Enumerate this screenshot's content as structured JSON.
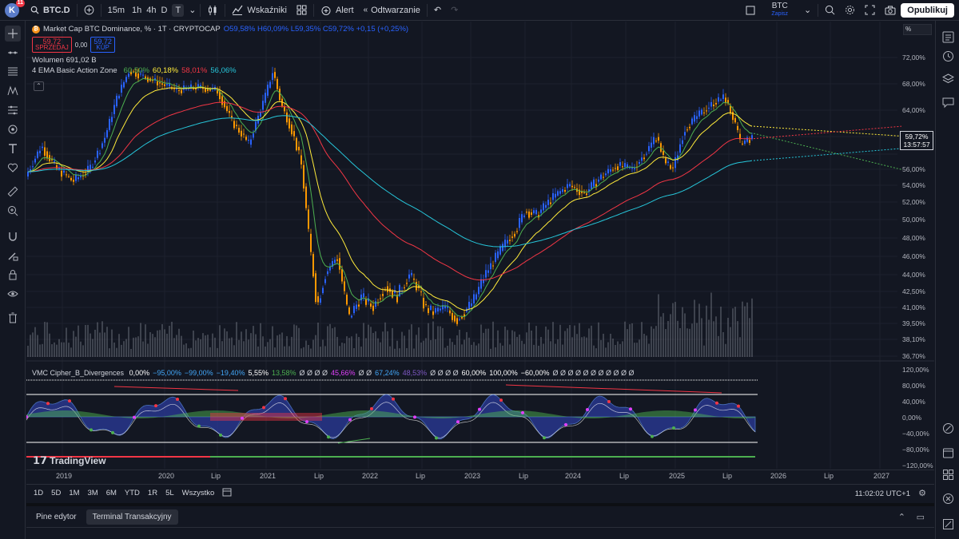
{
  "topbar": {
    "avatar_letter": "K",
    "avatar_badge": "11",
    "symbol": "BTC.D",
    "timeframes": [
      "15m",
      "1h",
      "4h",
      "D",
      "T"
    ],
    "active_timeframe": "T",
    "indicators_label": "Wskaźniki",
    "alert_label": "Alert",
    "replay_label": "Odtwarzanie",
    "symbol_box": "BTC",
    "symbol_box_sub": "Zapisz",
    "publish_label": "Opublikuj"
  },
  "legend": {
    "title": "Market Cap BTC Dominance, % · 1T · CRYPTOCAP",
    "ohlc": "O59,58% H60,09% L59,35% C59,72% +0,15 (+0,25%)",
    "sell_price": "59,72",
    "sell_label": "SPRZEDAJ",
    "spread": "0,00",
    "buy_price": "59,72",
    "buy_label": "KUP",
    "volume": "Wolumen  691,02 B",
    "ema_label": "4 EMA Basic Action Zone",
    "ema_values": [
      {
        "v": "60,50%",
        "color": "#4caf50"
      },
      {
        "v": "60,18%",
        "color": "#ffeb3b"
      },
      {
        "v": "58,01%",
        "color": "#f23645"
      },
      {
        "v": "56,06%",
        "color": "#26c6da"
      }
    ]
  },
  "cipher_legend": {
    "name": "VMC Cipher_B_Divergences",
    "values": [
      {
        "v": "0,00%",
        "color": "#ffffff"
      },
      {
        "v": "−95,00%",
        "color": "#42a5f5"
      },
      {
        "v": "−99,00%",
        "color": "#42a5f5"
      },
      {
        "v": "−19,40%",
        "color": "#42a5f5"
      },
      {
        "v": "5,55%",
        "color": "#ffffff"
      },
      {
        "v": "13,58%",
        "color": "#4caf50"
      },
      {
        "v": "Ø Ø Ø Ø",
        "color": "#d1d4dc"
      },
      {
        "v": "45,66%",
        "color": "#e040fb"
      },
      {
        "v": "Ø Ø",
        "color": "#d1d4dc"
      },
      {
        "v": "67,24%",
        "color": "#42a5f5"
      },
      {
        "v": "48,53%",
        "color": "#7e57c2"
      },
      {
        "v": "Ø Ø Ø Ø",
        "color": "#d1d4dc"
      },
      {
        "v": "60,00%",
        "color": "#ffffff"
      },
      {
        "v": "100,00%",
        "color": "#ffffff"
      },
      {
        "v": "−60,00%",
        "color": "#ffffff"
      },
      {
        "v": "Ø Ø Ø Ø Ø Ø Ø Ø Ø Ø Ø",
        "color": "#d1d4dc"
      }
    ]
  },
  "price_axis": {
    "unit_box": "%",
    "labels": [
      "72,00%",
      "68,00%",
      "64,00%",
      "60,00%",
      "58,00%",
      "56,00%",
      "54,00%",
      "52,00%",
      "50,00%",
      "48,00%",
      "46,00%",
      "44,00%",
      "42,50%",
      "41,00%",
      "39,50%",
      "38,10%",
      "36,70%"
    ],
    "current_price": "59,72%",
    "countdown": "13:57:57"
  },
  "osc_axis": {
    "labels": [
      "120,00%",
      "80,00%",
      "40,00%",
      "0,00%",
      "−40,00%",
      "−80,00%",
      "−120,00%"
    ]
  },
  "time_axis": {
    "labels": [
      "2019",
      "2020",
      "Lip",
      "2021",
      "Lip",
      "2022",
      "Lip",
      "2023",
      "Lip",
      "2024",
      "Lip",
      "2025",
      "Lip",
      "2026",
      "Lip",
      "2027"
    ]
  },
  "watermark": "TradingView",
  "range_bar": {
    "ranges": [
      "1D",
      "5D",
      "1M",
      "3M",
      "6M",
      "YTD",
      "1R",
      "5L",
      "Wszystko"
    ],
    "clock": "11:02:02 UTC+1"
  },
  "bottom_panel": {
    "tabs": [
      "Pine edytor",
      "Terminal Transakcyjny"
    ],
    "active_tab": "Terminal Transakcyjny"
  },
  "colors": {
    "background": "#131722",
    "up": "#2962ff",
    "down": "#ff9800",
    "ema_fast": "#4caf50",
    "ema_mid": "#ffeb3b",
    "ema_slow": "#f23645",
    "ema_long": "#26c6da"
  }
}
